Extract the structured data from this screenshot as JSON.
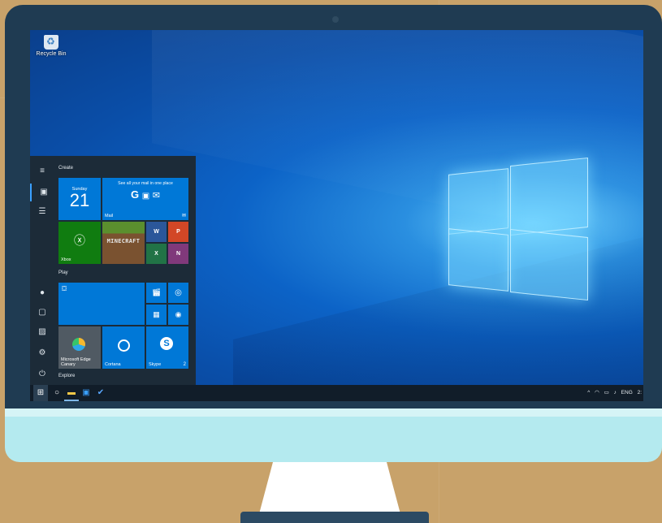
{
  "desktop": {
    "recycle_bin_label": "Recycle Bin"
  },
  "start_menu": {
    "groups": {
      "create": "Create",
      "play": "Play",
      "explore": "Explore"
    },
    "calendar": {
      "day_name": "Sunday",
      "day_number": "21"
    },
    "mail": {
      "headline": "See all your mail in one place",
      "label": "Mail"
    },
    "xbox": {
      "label": "Xbox"
    },
    "minecraft": {
      "label": "MINECRAFT"
    },
    "office": {
      "word": "W",
      "powerpoint": "P",
      "excel": "X",
      "onenote": "N"
    },
    "edge": {
      "label_line1": "Microsoft Edge",
      "label_line2": "Canary"
    },
    "cortana": {
      "label": "Cortana"
    },
    "skype": {
      "label": "Skype",
      "badge": "2"
    }
  },
  "taskbar": {
    "language": "ENG",
    "clock": "2:",
    "tray_chevron": "^"
  },
  "colors": {
    "tile_blue": "#0078d7",
    "xbox_green": "#107c10",
    "edge_gray": "#505a63",
    "word": "#2b579a",
    "powerpoint": "#d24726",
    "excel": "#217346",
    "onenote": "#80397b"
  }
}
